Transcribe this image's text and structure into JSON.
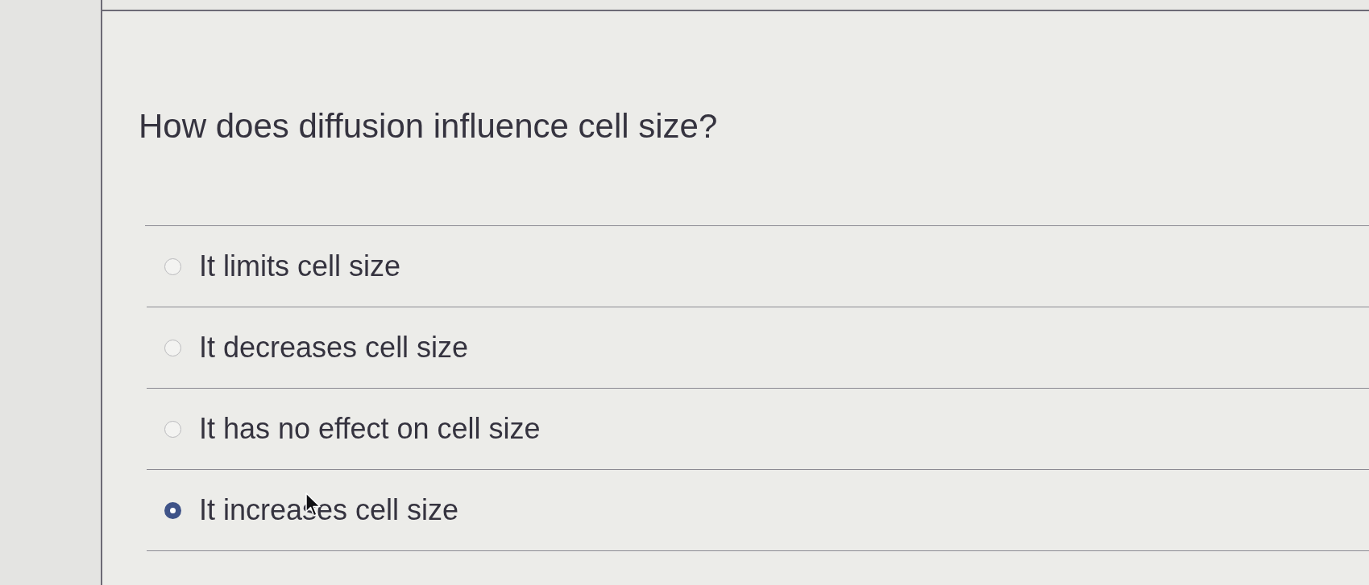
{
  "question": {
    "text": "How does diffusion influence cell size?"
  },
  "options": [
    {
      "label": "It limits cell size",
      "selected": false
    },
    {
      "label": "It decreases cell size",
      "selected": false
    },
    {
      "label": "It has no effect on cell size",
      "selected": false
    },
    {
      "label": "It increases cell size",
      "selected": true
    }
  ]
}
